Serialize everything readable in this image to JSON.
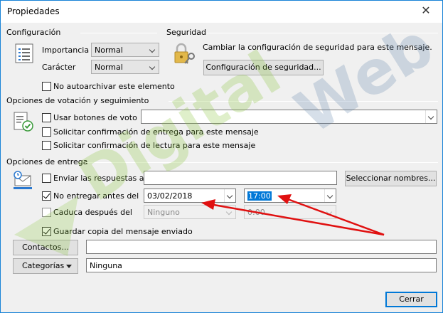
{
  "window": {
    "title": "Propiedades",
    "close_glyph": "✕"
  },
  "configuracion": {
    "title": "Configuración",
    "importancia_label": "Importancia",
    "importancia_value": "Normal",
    "caracter_label": "Carácter",
    "caracter_value": "Normal",
    "no_autoarchivar_label": "No autoarchivar este elemento",
    "no_autoarchivar_checked": false
  },
  "seguridad": {
    "title": "Seguridad",
    "description": "Cambiar la configuración de seguridad para este mensaje.",
    "button_label": "Configuración de seguridad..."
  },
  "votacion": {
    "title": "Opciones de votación y seguimiento",
    "usar_botones_label": "Usar botones de voto",
    "usar_botones_value": "",
    "confirmacion_entrega_label": "Solicitar confirmación de entrega para este mensaje",
    "confirmacion_lectura_label": "Solicitar confirmación de lectura para este mensaje"
  },
  "entrega": {
    "title": "Opciones de entrega",
    "enviar_respuestas_label": "Enviar las respuestas a",
    "enviar_respuestas_value": "",
    "seleccionar_nombres_label": "Seleccionar nombres...",
    "no_entregar_label": "No entregar antes del",
    "no_entregar_checked": true,
    "no_entregar_date": "03/02/2018",
    "no_entregar_time": "17:00",
    "caduca_label": "Caduca después del",
    "caduca_checked": false,
    "caduca_date": "Ninguno",
    "caduca_time": "0:00",
    "guardar_copia_label": "Guardar copia del mensaje enviado",
    "guardar_copia_checked": true
  },
  "contactos": {
    "button_label": "Contactos...",
    "value": ""
  },
  "categorias": {
    "button_label": "Categorías",
    "value": "Ninguna"
  },
  "footer": {
    "cerrar_label": "Cerrar"
  },
  "watermark_text": "DigitalWeb",
  "colors": {
    "accent": "#0078d7",
    "arrow": "#e01010",
    "watermark_green": "#8cc63f",
    "watermark_blue": "#5b7fa6"
  }
}
